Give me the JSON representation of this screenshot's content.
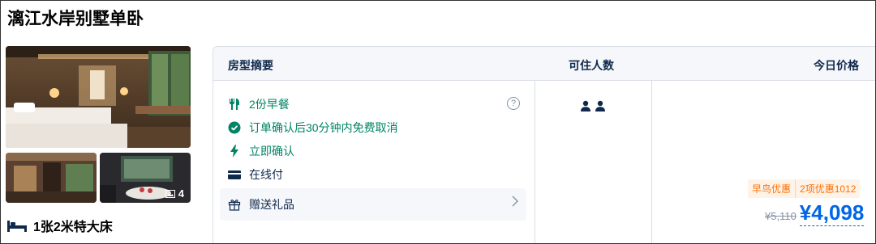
{
  "room": {
    "title": "漓江水岸别墅单卧",
    "photo_count": "4",
    "bed": "1张2米特大床"
  },
  "table": {
    "headers": [
      "房型摘要",
      "可住人数",
      "今日价格"
    ],
    "features": [
      {
        "icon": "cutlery-icon",
        "text": "2份早餐",
        "color": "#008464"
      },
      {
        "icon": "check-circle-icon",
        "text": "订单确认后30分钟内免费取消",
        "color": "#008464"
      },
      {
        "icon": "lightning-icon",
        "text": "立即确认",
        "color": "#008464"
      },
      {
        "icon": "card-icon",
        "text": "在线付",
        "color": "#0f294d"
      }
    ],
    "help_glyph": "?",
    "gift": {
      "label": "赠送礼品"
    },
    "guests": 2
  },
  "pricing": {
    "tag1": "早鸟优惠",
    "tag2": "2项优惠1012",
    "old_price": "¥5,110",
    "new_price": "¥4,098"
  },
  "colors": {
    "green": "#008464",
    "blue": "#0066e5",
    "orange": "#ff6f00",
    "text": "#0f294d"
  }
}
